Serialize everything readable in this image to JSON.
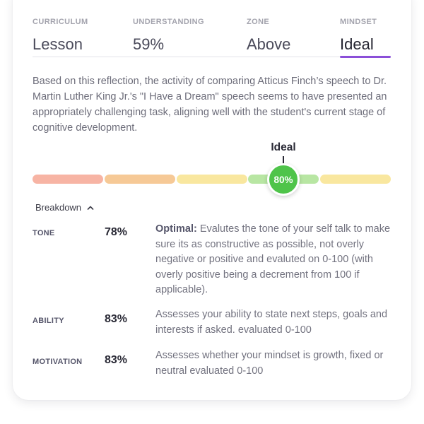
{
  "metrics": [
    {
      "label": "CURRICULUM",
      "value": "Lesson"
    },
    {
      "label": "UNDERSTANDING",
      "value": "59%"
    },
    {
      "label": "ZONE",
      "value": "Above"
    },
    {
      "label": "MINDSET",
      "value": "Ideal"
    }
  ],
  "active_metric": "MINDSET",
  "summary": "Based on this reflection, the activity of comparing Atticus Finch’s speech to Dr. Martin Luther King Jr.'s \"I Have a Dream\" speech seems to have presented an appropriately challenging task, aligning well with the student's current stage of cognitive development.",
  "gauge": {
    "marker_label": "Ideal",
    "value": "80%",
    "segment_colors": [
      "#f7b4a4",
      "#f6c996",
      "#f9e79f",
      "#b8e6a3",
      "#f9e79f"
    ],
    "knob_color": "#4fc44a"
  },
  "breakdown": {
    "toggle_label": "Breakdown",
    "toggle_icon": "chevron-up-icon",
    "rows": [
      {
        "label": "TONE",
        "score": "78%",
        "desc_prefix": "Optimal:",
        "desc": "Evalutes the tone of your self talk to make sure its as constructive as possible, not overly negative or positive and evaluted on 0-100 (with overly positive being a decrement from 100 if applicable)."
      },
      {
        "label": "ABILITY",
        "score": "83%",
        "desc_prefix": "",
        "desc": "Assesses your ability to state next steps, goals and interests if asked. evaluated 0-100"
      },
      {
        "label": "MOTIVATION",
        "score": "83%",
        "desc_prefix": "",
        "desc": "Assesses whether your mindset is growth, fixed or neutral evaluated 0-100"
      }
    ]
  },
  "colors": {
    "accent": "#8b4fd8"
  }
}
